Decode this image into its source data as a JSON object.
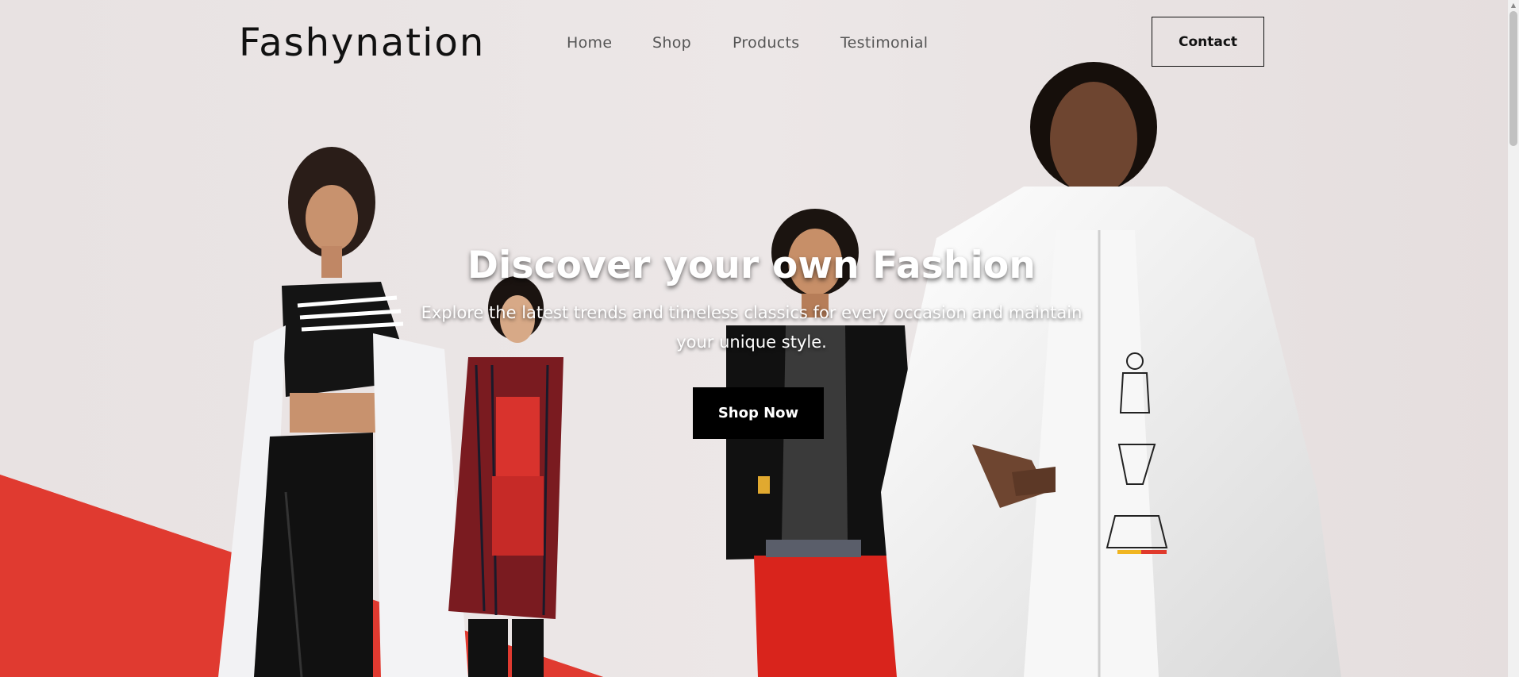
{
  "brand": {
    "logo": "Fashynation"
  },
  "nav": {
    "items": [
      {
        "label": "Home"
      },
      {
        "label": "Shop"
      },
      {
        "label": "Products"
      },
      {
        "label": "Testimonial"
      }
    ],
    "contact_label": "Contact"
  },
  "hero": {
    "title": "Discover your own Fashion",
    "subtitle": "Explore the latest trends and timeless classics for every occasion and maintain your unique style.",
    "cta_label": "Shop Now"
  },
  "colors": {
    "background": "#e9e3e3",
    "accent_red": "#e0322c",
    "button_black": "#000000"
  }
}
